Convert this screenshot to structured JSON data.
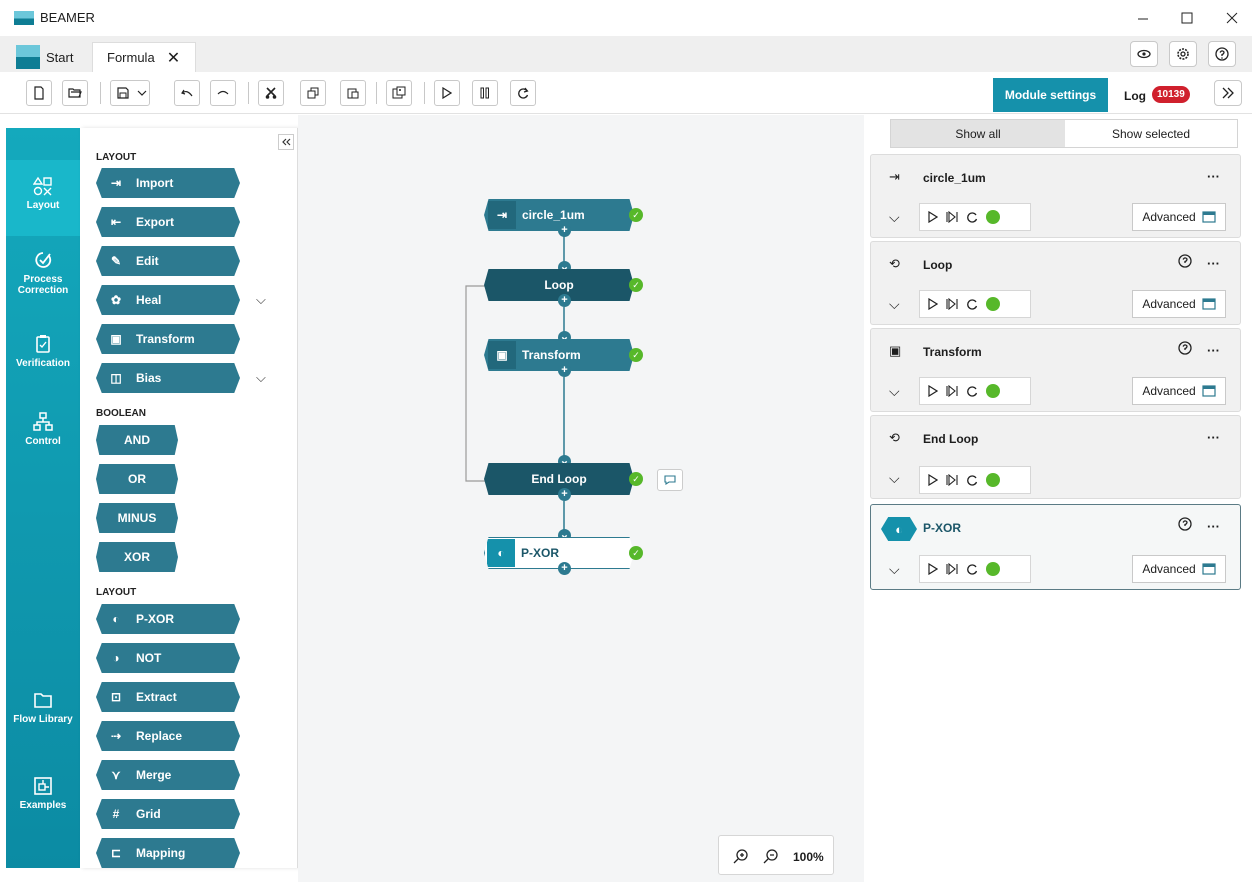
{
  "window": {
    "title": "BEAMER"
  },
  "tabs": [
    {
      "label": "Start"
    },
    {
      "label": "Formula",
      "close": "✕"
    }
  ],
  "toolbar": {
    "module_settings": "Module settings",
    "log_label": "Log",
    "log_count": "10139"
  },
  "rail": [
    {
      "label": "Layout"
    },
    {
      "label": "Process Correction"
    },
    {
      "label": "Verification"
    },
    {
      "label": "Control"
    },
    {
      "label": "Flow Library"
    },
    {
      "label": "Examples"
    }
  ],
  "palette": {
    "sections": [
      "LAYOUT",
      "BOOLEAN",
      "LAYOUT"
    ],
    "layout1": [
      "Import",
      "Export",
      "Edit",
      "Heal",
      "Transform",
      "Bias"
    ],
    "boolean": [
      "AND",
      "OR",
      "MINUS",
      "XOR"
    ],
    "layout2": [
      "P-XOR",
      "NOT",
      "Extract",
      "Replace",
      "Merge",
      "Grid",
      "Mapping"
    ]
  },
  "flow": {
    "nodes": [
      "circle_1um",
      "Loop",
      "Transform",
      "End Loop",
      "P-XOR"
    ]
  },
  "zoom": {
    "level": "100%"
  },
  "right_panel": {
    "show_all": "Show all",
    "show_selected": "Show selected",
    "advanced_label": "Advanced",
    "modules": [
      {
        "name": "circle_1um"
      },
      {
        "name": "Loop"
      },
      {
        "name": "Transform"
      },
      {
        "name": "End Loop"
      },
      {
        "name": "P-XOR"
      }
    ]
  }
}
